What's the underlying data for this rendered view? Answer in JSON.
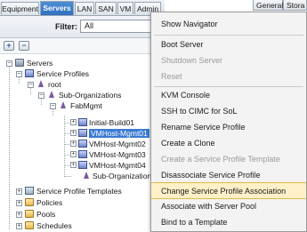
{
  "nav_tabs": [
    "Equipment",
    "Servers",
    "LAN",
    "SAN",
    "VM",
    "Admin"
  ],
  "active_tab": "Servers",
  "filter": {
    "label": "Filter:",
    "value": "All"
  },
  "toolbar": {
    "expand": "+",
    "collapse": "−"
  },
  "tree": {
    "root": "Servers",
    "service_profiles": "Service Profiles",
    "root_org": "root",
    "sub_orgs": "Sub-Organizations",
    "fabmgmt": "FabMgmt",
    "initial_build": "Initial-Build01",
    "vmhost1": "VMHost-Mgmt01",
    "vmhost2": "VMHost-Mgmt02",
    "vmhost3": "VMHost-Mgmt03",
    "vmhost4": "VMHost-Mgmt04",
    "sub_org_partial": "Sub-Organization",
    "sp_templates": "Service Profile Templates",
    "policies": "Policies",
    "pools": "Pools",
    "schedules": "Schedules"
  },
  "right_tabs": [
    "General",
    "Stora"
  ],
  "context_menu": [
    {
      "label": "Show Navigator",
      "disabled": false
    },
    {
      "label": "Boot Server",
      "disabled": false
    },
    {
      "label": "Shutdown Server",
      "disabled": true
    },
    {
      "label": "Reset",
      "disabled": true
    },
    {
      "label": "KVM Console",
      "disabled": false
    },
    {
      "label": "SSH to CIMC for SoL",
      "disabled": false
    },
    {
      "label": "Rename Service Profile",
      "disabled": false
    },
    {
      "label": "Create a Clone",
      "disabled": false
    },
    {
      "label": "Create a Service Profile Template",
      "disabled": true
    },
    {
      "label": "Disassociate Service Profile",
      "disabled": false
    },
    {
      "label": "Change Service Profile Association",
      "disabled": false
    },
    {
      "label": "Associate with Server Pool",
      "disabled": false
    },
    {
      "label": "Bind to a Template",
      "disabled": false
    }
  ],
  "highlighted_menu_item": "Change Service Profile Association",
  "colors": {
    "selection": "#3a7ad2",
    "active_tab": "#2f6fbd",
    "menu_highlight": "#fff0c8"
  }
}
